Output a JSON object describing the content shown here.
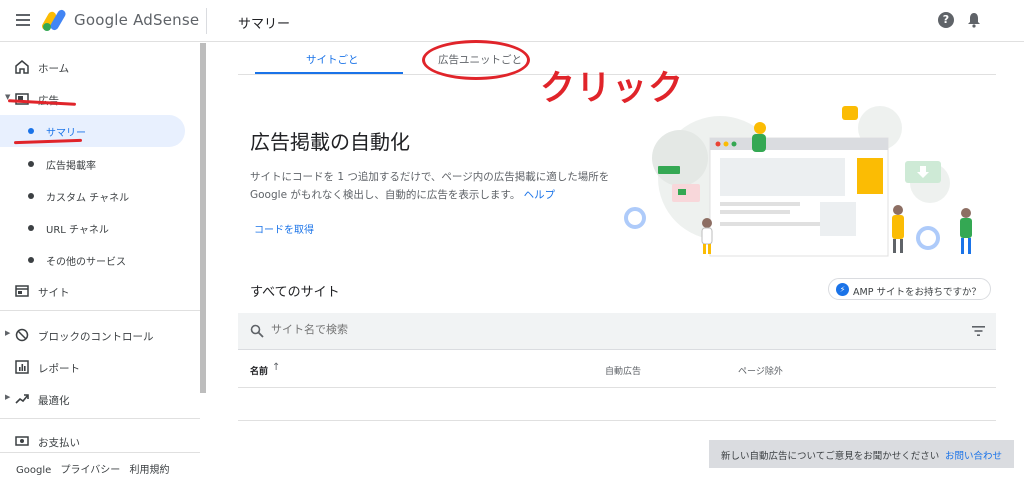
{
  "app": {
    "logo_text": "Google AdSense",
    "page_title": "サマリー"
  },
  "sidebar": {
    "items": [
      {
        "label": "ホーム"
      },
      {
        "label": "広告"
      },
      {
        "label": "サマリー"
      },
      {
        "label": "広告掲載率"
      },
      {
        "label": "カスタム チャネル"
      },
      {
        "label": "URL チャネル"
      },
      {
        "label": "その他のサービス"
      },
      {
        "label": "サイト"
      },
      {
        "label": "ブロックのコントロール"
      },
      {
        "label": "レポート"
      },
      {
        "label": "最適化"
      },
      {
        "label": "お支払い"
      }
    ],
    "footer": {
      "google": "Google",
      "privacy": "プライバシー",
      "terms": "利用規約"
    }
  },
  "tabs": [
    {
      "label": "サイトごと"
    },
    {
      "label": "広告ユニットごと"
    }
  ],
  "annotation": {
    "click_text": "クリック"
  },
  "hero": {
    "title": "広告掲載の自動化",
    "description": "サイトにコードを 1 つ追加するだけで、ページ内の広告掲載に適した場所を Google がもれなく検出し、自動的に広告を表示します。",
    "help_link": "ヘルプ",
    "get_code": "コードを取得"
  },
  "sites": {
    "heading": "すべてのサイト",
    "amp_button": "AMP サイトをお持ちですか？",
    "search_placeholder": "サイト名で検索",
    "columns": {
      "name": "名前",
      "auto_ads": "自動広告",
      "page_exclusions": "ページ除外"
    }
  },
  "feedback": {
    "text": "新しい自動広告についてご意見をお聞かせください",
    "link": "お問い合わせ"
  },
  "colors": {
    "accent": "#1a73e8",
    "annotation_red": "#e0242a"
  }
}
